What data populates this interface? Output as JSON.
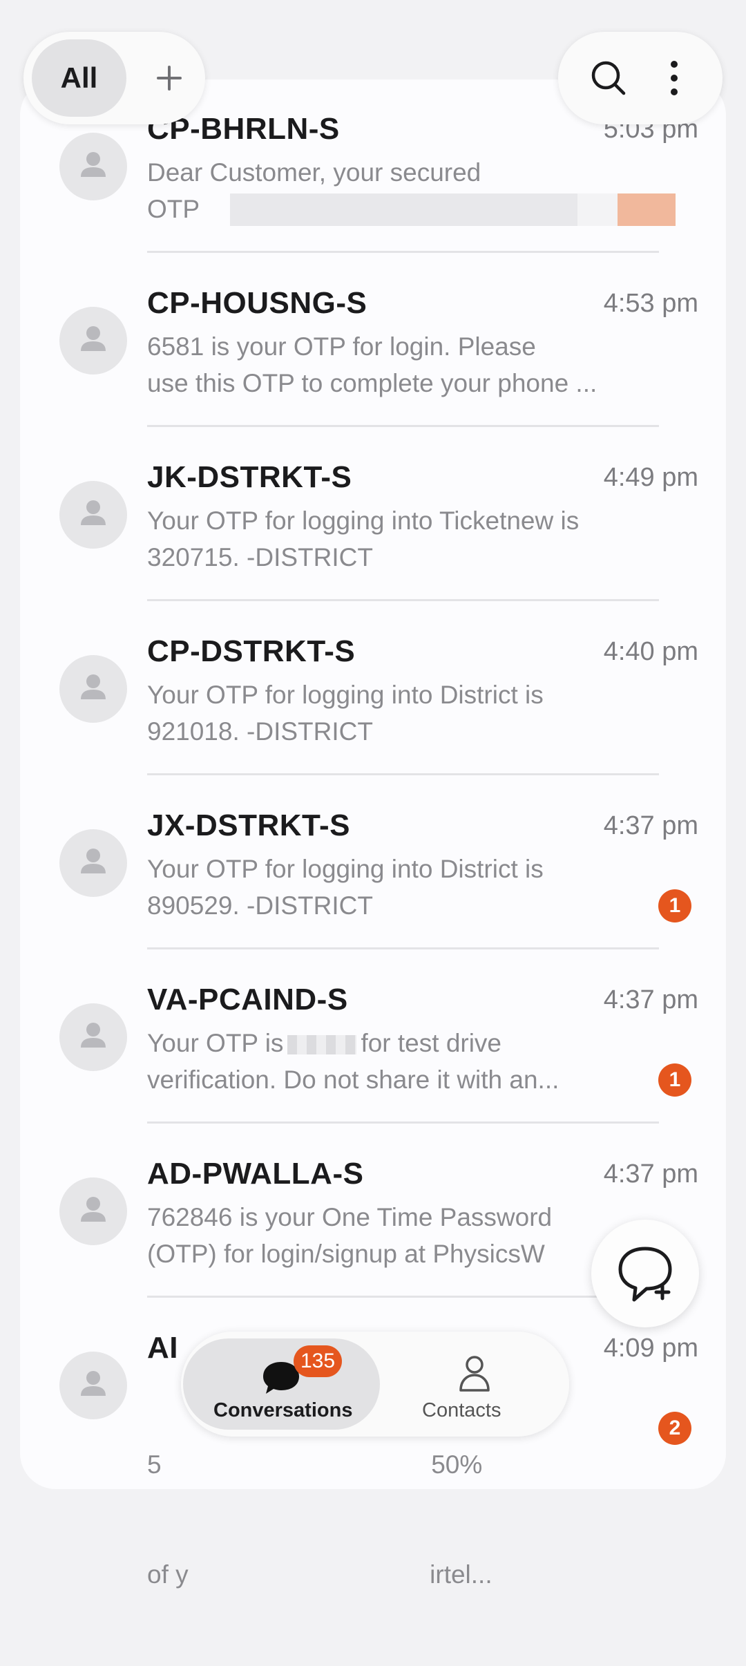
{
  "filters": {
    "all_label": "All"
  },
  "conversations": [
    {
      "sender": "CP-BHRLN-S",
      "time": "5:03 pm",
      "line1": "Dear Customer, your secured",
      "line2": "OTP",
      "badge": ""
    },
    {
      "sender": "CP-HOUSNG-S",
      "time": "4:53 pm",
      "line1": "6581  is your OTP for login. Please",
      "line2": "use this OTP to complete your phone ...",
      "badge": ""
    },
    {
      "sender": "JK-DSTRKT-S",
      "time": "4:49 pm",
      "line1": "Your OTP for logging into Ticketnew is",
      "line2": "320715. -DISTRICT",
      "badge": ""
    },
    {
      "sender": "CP-DSTRKT-S",
      "time": "4:40 pm",
      "line1": "Your OTP for logging into District is",
      "line2": "921018. -DISTRICT",
      "badge": ""
    },
    {
      "sender": "JX-DSTRKT-S",
      "time": "4:37 pm",
      "line1": "Your OTP for logging into District is",
      "line2": "890529. -DISTRICT",
      "badge": "1"
    },
    {
      "sender": "VA-PCAIND-S",
      "time": "4:37 pm",
      "line1a": "Your OTP is",
      "line1b": "for test drive",
      "line2": "verification. Do not share it with an...",
      "badge": "1"
    },
    {
      "sender": "AD-PWALLA-S",
      "time": "4:37 pm",
      "line1": "762846 is your One Time Password",
      "line2": "(OTP) for login/signup at PhysicsW",
      "badge": ""
    },
    {
      "sender": "AI",
      "time": "4:09 pm",
      "line1": "5                                      50%",
      "line2": "of y                                  irtel...",
      "badge": "2"
    }
  ],
  "bottom_nav": {
    "conversations_label": "Conversations",
    "conversations_count": "135",
    "contacts_label": "Contacts"
  },
  "colors": {
    "accent": "#e5561e",
    "background": "#f2f2f4",
    "card": "#fcfcfe"
  },
  "icons": [
    "plus-icon",
    "search-icon",
    "more-vert-icon",
    "person-icon",
    "chat-bubble-icon",
    "contacts-icon",
    "new-chat-icon"
  ]
}
